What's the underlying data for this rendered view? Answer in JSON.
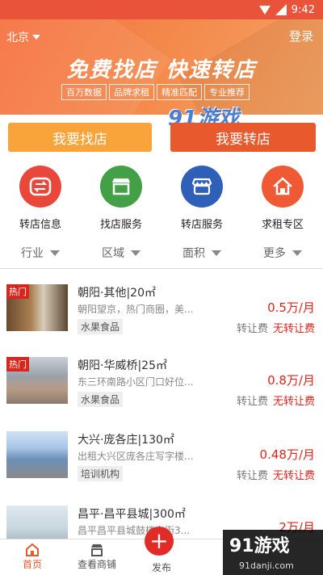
{
  "status": {
    "time": "9:42"
  },
  "header": {
    "city": "北京",
    "login": "登录",
    "slogan": "免费找店 快速转店",
    "tags": [
      "百万数据",
      "品牌求租",
      "精准匹配",
      "专业推荐"
    ],
    "watermark": "91游戏"
  },
  "actions": {
    "find": "我要找店",
    "transfer": "我要转店"
  },
  "categories": [
    {
      "label": "转店信息",
      "icon": "transfer-icon",
      "color": "#e9473a"
    },
    {
      "label": "找店服务",
      "icon": "shop-icon",
      "color": "#43a047"
    },
    {
      "label": "转店服务",
      "icon": "store-icon",
      "color": "#2f5fb8"
    },
    {
      "label": "求租专区",
      "icon": "home-icon",
      "color": "#ef5a34"
    }
  ],
  "filters": [
    "行业",
    "区域",
    "面积",
    "更多"
  ],
  "listings": [
    {
      "hot": "热门",
      "title": "朝阳·其他|20㎡",
      "desc": "朝阳望京，热门商圈，美...",
      "tag": "水果食品",
      "price": "0.5万/月",
      "fee_label": "转让费",
      "fee": "无转让费"
    },
    {
      "hot": "热门",
      "title": "朝阳·华威桥|25㎡",
      "desc": "东三环南路小区门口好位...",
      "tag": "水果食品",
      "price": "0.8万/月",
      "fee_label": "转让费",
      "fee": "无转让费"
    },
    {
      "hot": "",
      "title": "大兴·庞各庄|130㎡",
      "desc": "出租大兴区庞各庄写字楼...",
      "tag": "培训机构",
      "price": "0.48万/月",
      "fee_label": "转让费",
      "fee": "无转让费"
    },
    {
      "hot": "",
      "title": "昌平·昌平县城|300㎡",
      "desc": "昌平昌平县城鼓楼东街3...",
      "tag": "",
      "price": "2万/月",
      "fee_label": "",
      "fee": ""
    }
  ],
  "bottom_nav": {
    "home": "首页",
    "view": "查看商铺",
    "publish": "发布"
  },
  "watermark_bottom": {
    "big": "91游戏",
    "small": "91danji.com"
  },
  "accent": "#e9592e"
}
